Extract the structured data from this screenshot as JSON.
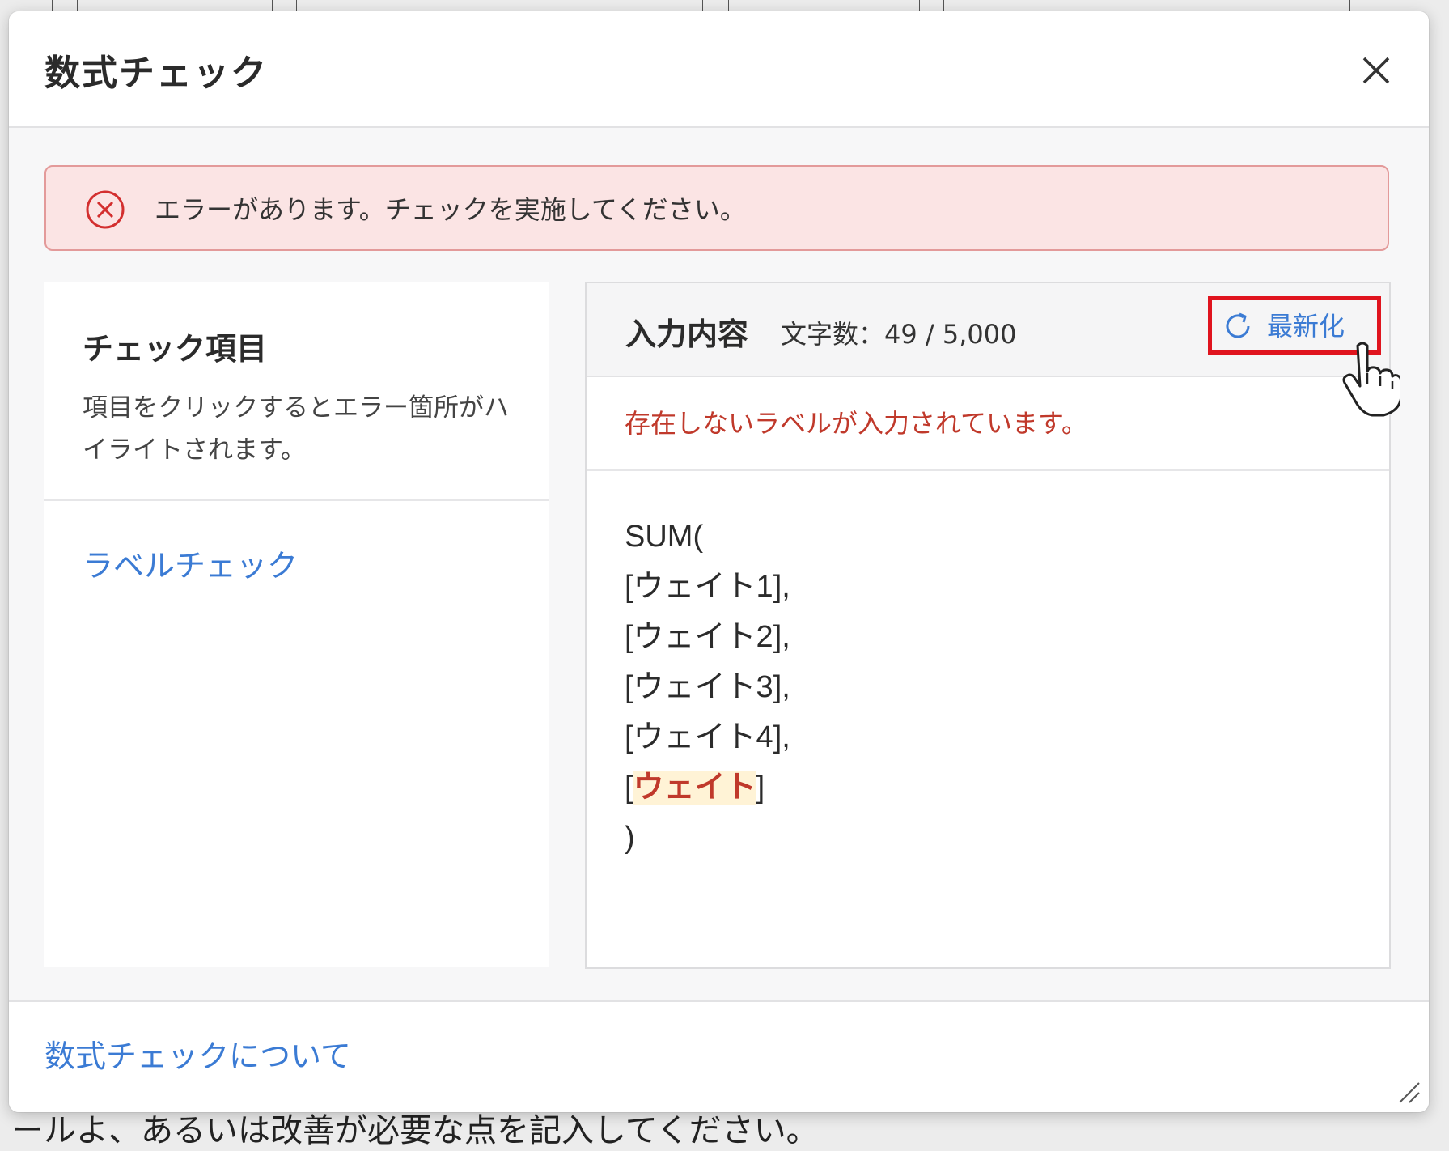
{
  "background": {
    "bottom_text": "ールよ、あるいは改善が必要な点を記入してください。"
  },
  "dialog": {
    "title": "数式チェック",
    "close_icon": "close-icon"
  },
  "alert": {
    "icon": "error-circle-icon",
    "message": "エラーがあります。チェックを実施してください。",
    "color": "#fbe4e4"
  },
  "check_items": {
    "title": "チェック項目",
    "description": "項目をクリックするとエラー箇所がハイライトされます。",
    "items": [
      {
        "label": "ラベルチェック"
      }
    ]
  },
  "input": {
    "title": "入力内容",
    "char_count": "文字数：49 / 5,000",
    "refresh_label": "最新化",
    "refresh_icon": "refresh-icon",
    "error_message": "存在しないラベルが入力されています。",
    "formula_lines": [
      {
        "text": "SUM("
      },
      {
        "text": "[ウェイト1],"
      },
      {
        "text": "[ウェイト2],"
      },
      {
        "text": "[ウェイト3],"
      },
      {
        "text": "[ウェイト4],"
      },
      {
        "prefix": "[",
        "highlight": "ウェイト",
        "suffix": "]"
      },
      {
        "text": ")"
      }
    ]
  },
  "footer": {
    "link": "数式チェックについて"
  },
  "colors": {
    "link": "#3b7bd4",
    "error": "#c0392b",
    "highlight_box": "#e0141e"
  }
}
